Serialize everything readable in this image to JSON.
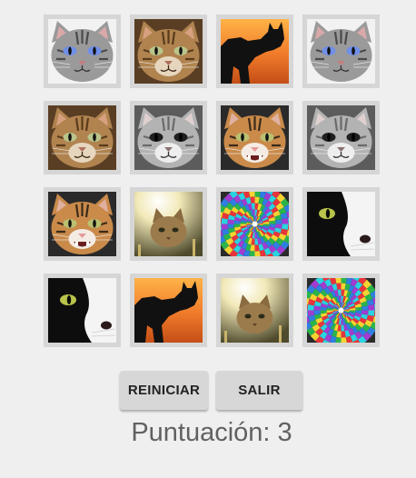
{
  "board": {
    "cards": [
      {
        "image": "blue-eyed-gray-cat"
      },
      {
        "image": "brown-tabby-cat"
      },
      {
        "image": "cat-silhouette-sunset"
      },
      {
        "image": "blue-eyed-gray-cat"
      },
      {
        "image": "brown-tabby-cat"
      },
      {
        "image": "gray-kitten-bw"
      },
      {
        "image": "calico-cat-mouth-open"
      },
      {
        "image": "gray-kitten-bw"
      },
      {
        "image": "calico-cat-mouth-open"
      },
      {
        "image": "kitten-in-light"
      },
      {
        "image": "psychedelic-spiral"
      },
      {
        "image": "black-white-cat-closeup"
      },
      {
        "image": "black-white-cat-closeup"
      },
      {
        "image": "cat-silhouette-sunset"
      },
      {
        "image": "kitten-in-light"
      },
      {
        "image": "psychedelic-spiral"
      }
    ]
  },
  "buttons": {
    "restart_label": "REINICIAR",
    "exit_label": "SALIR"
  },
  "score": {
    "text": "Puntuación: 3"
  },
  "colors": {
    "background": "#efefef",
    "card_frame": "#d6d6d6",
    "button": "#d7d7d7",
    "score_text": "#616161"
  }
}
